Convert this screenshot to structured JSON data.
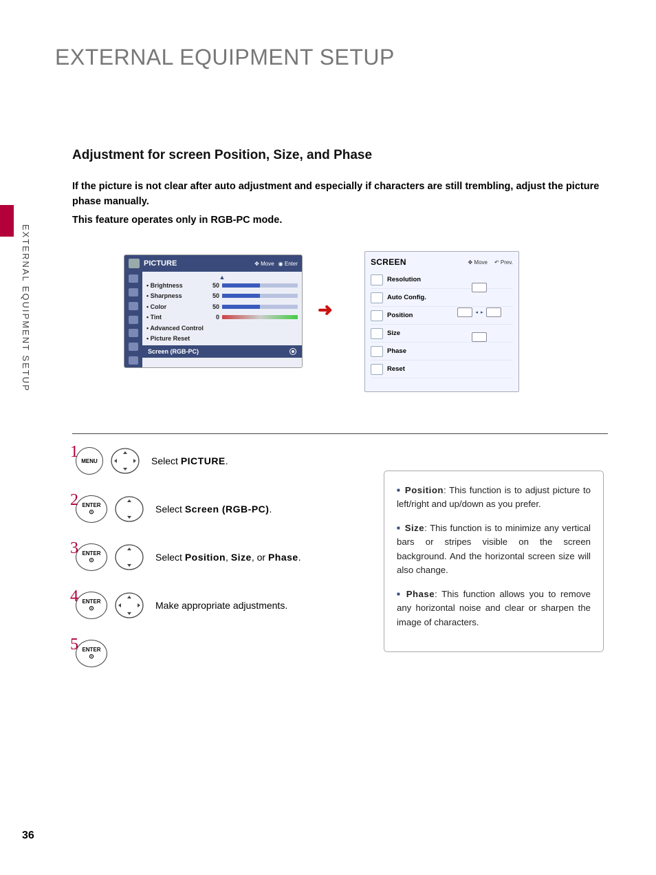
{
  "page_title": "EXTERNAL EQUIPMENT SETUP",
  "side_label": "EXTERNAL EQUIPMENT SETUP",
  "section_title": "Adjustment for screen Position, Size, and Phase",
  "body_para1": "If the picture is not clear after auto adjustment and especially if characters are still trembling, adjust the picture phase manually.",
  "body_para2": "This feature operates only in RGB-PC mode.",
  "picture_osd": {
    "title": "PICTURE",
    "hint_move": "Move",
    "hint_enter": "Enter",
    "rows": [
      {
        "label": "• Brightness",
        "value": "50"
      },
      {
        "label": "• Sharpness",
        "value": "50"
      },
      {
        "label": "• Color",
        "value": "50"
      },
      {
        "label": "• Tint",
        "value": "0"
      },
      {
        "label": "• Advanced Control",
        "value": ""
      },
      {
        "label": "• Picture Reset",
        "value": ""
      }
    ],
    "selected": "Screen (RGB-PC)"
  },
  "screen_osd": {
    "title": "SCREEN",
    "hint_move": "Move",
    "hint_prev": "Prev.",
    "items": [
      "Resolution",
      "Auto Config.",
      "Position",
      "Size",
      "Phase",
      "Reset"
    ]
  },
  "steps": [
    {
      "num": "1",
      "btn": "MENU",
      "dpad": "4way",
      "desc_pre": "Select ",
      "desc_b": "PICTURE",
      "desc_post": "."
    },
    {
      "num": "2",
      "btn": "ENTER",
      "dpad": "updown",
      "desc_pre": "Select ",
      "desc_b": "Screen (RGB-PC)",
      "desc_post": "."
    },
    {
      "num": "3",
      "btn": "ENTER",
      "dpad": "updown",
      "desc_pre": "Select ",
      "desc_b": "Position",
      "desc_mid": ", ",
      "desc_b2": "Size",
      "desc_mid2": ", or ",
      "desc_b3": "Phase",
      "desc_post": "."
    },
    {
      "num": "4",
      "btn": "ENTER",
      "dpad": "4way",
      "desc_pre": "Make appropriate adjustments.",
      "desc_b": "",
      "desc_post": ""
    },
    {
      "num": "5",
      "btn": "ENTER",
      "dpad": "",
      "desc_pre": "",
      "desc_b": "",
      "desc_post": ""
    }
  ],
  "info": [
    {
      "b": "Position",
      "rest": ": This function is to adjust picture to left/right and up/down as you prefer."
    },
    {
      "b": "Size",
      "rest": ": This function is to minimize any vertical bars or stripes visible on the screen background. And the horizontal screen size will also change."
    },
    {
      "b": "Phase",
      "rest": ": This function allows you to remove any horizontal noise and clear or sharpen the image of characters."
    }
  ],
  "page_number": "36"
}
